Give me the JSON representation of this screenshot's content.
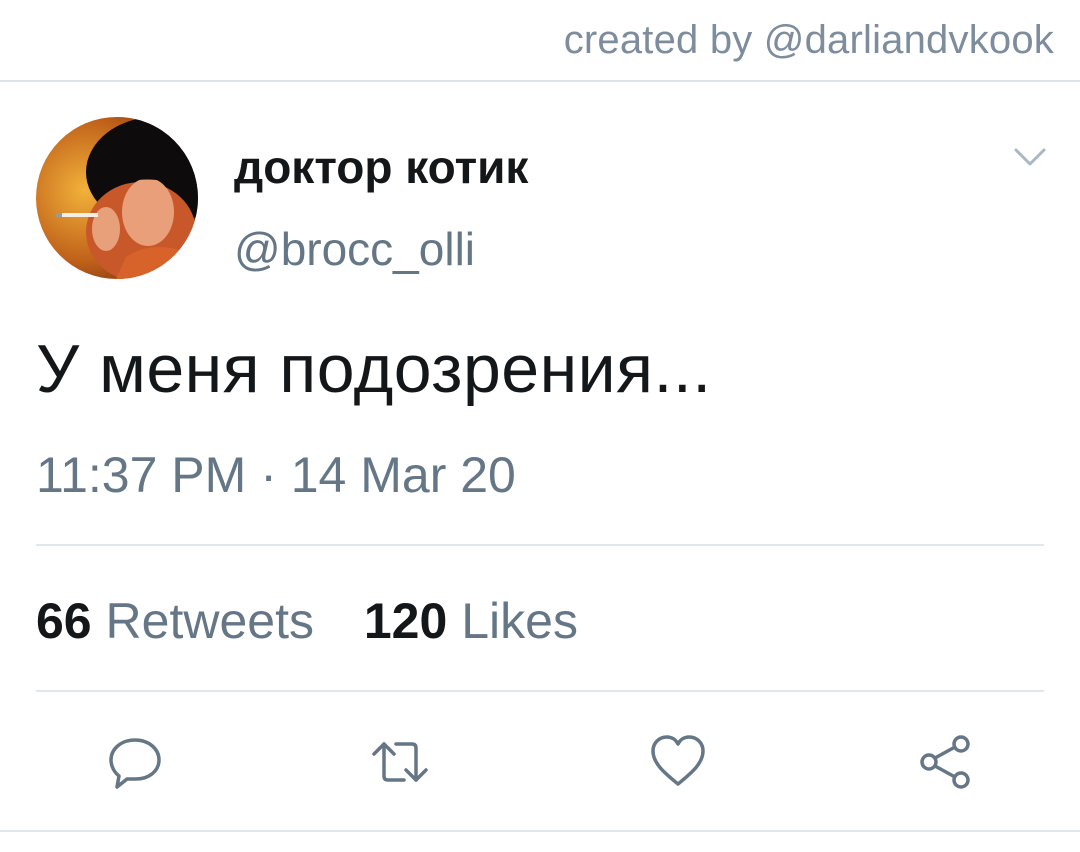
{
  "watermark": "created by @darliandvkook",
  "tweet": {
    "display_name": "доктор котик",
    "handle": "@brocc_olli",
    "text": "У меня подозрения...",
    "timestamp": "11:37 PM · 14 Mar 20"
  },
  "stats": {
    "retweets_count": "66",
    "retweets_label": "Retweets",
    "likes_count": "120",
    "likes_label": "Likes"
  },
  "icons": {
    "caret": "chevron-down-icon",
    "reply": "reply-icon",
    "retweet": "retweet-icon",
    "like": "heart-icon",
    "share": "share-icon"
  },
  "colors": {
    "primary_text": "#14171a",
    "secondary_text": "#657786",
    "icon": "#657786",
    "divider": "#e1e8ed"
  }
}
